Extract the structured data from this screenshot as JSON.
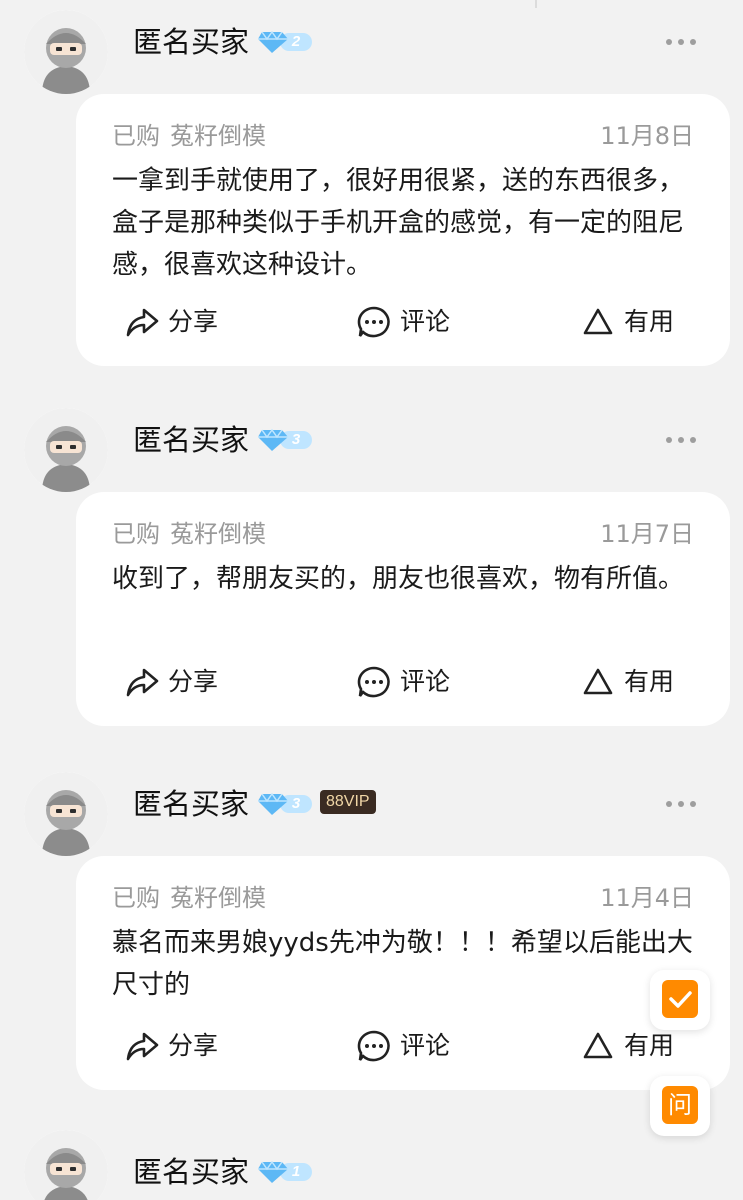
{
  "reviews": [
    {
      "username": "匿名买家",
      "level": "2",
      "vip": "",
      "purchased_label": "已购",
      "sku": "菟籽倒模",
      "date": "11月8日",
      "content": "一拿到手就使用了，很好用很紧，送的东西很多，盒子是那种类似于手机开盒的感觉，有一定的阻尼感，很喜欢这种设计。"
    },
    {
      "username": "匿名买家",
      "level": "3",
      "vip": "",
      "purchased_label": "已购",
      "sku": "菟籽倒模",
      "date": "11月7日",
      "content": "收到了，帮朋友买的，朋友也很喜欢，物有所值。"
    },
    {
      "username": "匿名买家",
      "level": "3",
      "vip": "88VIP",
      "purchased_label": "已购",
      "sku": "菟籽倒模",
      "date": "11月4日",
      "content": "慕名而来男娘yyds先冲为敬！！！希望以后能出大尺寸的"
    },
    {
      "username": "匿名买家",
      "level": "1",
      "vip": ""
    }
  ],
  "actions": {
    "share": "分享",
    "comment": "评论",
    "useful": "有用"
  },
  "floating": {
    "ask": "问"
  },
  "colors": {
    "accent": "#ff8a00",
    "gem": "#5db8f5",
    "muted": "#9a9a9a"
  }
}
